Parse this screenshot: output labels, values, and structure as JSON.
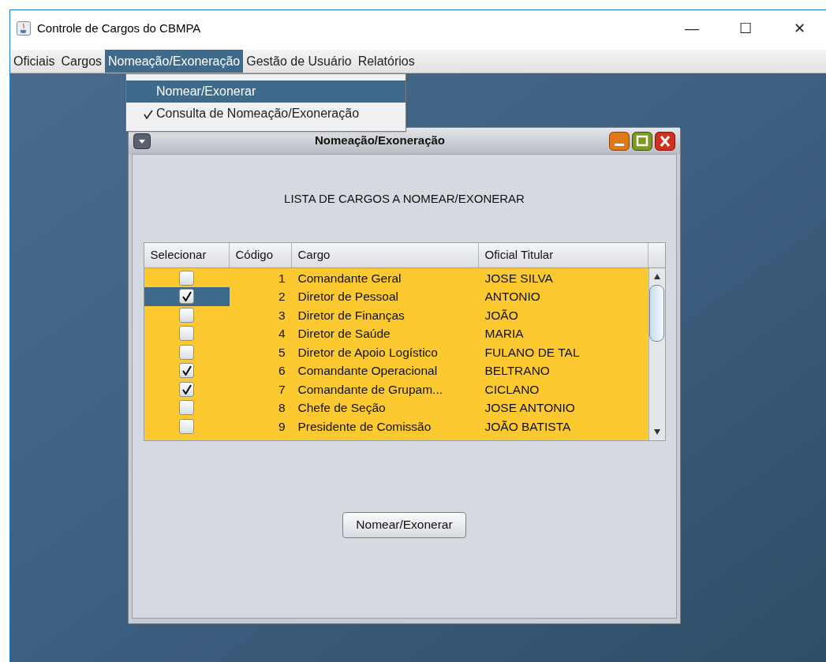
{
  "window": {
    "title": "Controle de Cargos do CBMPA",
    "controls": [
      "—",
      "☐",
      "✕"
    ]
  },
  "menu_bar": [
    {
      "label": "Oficiais",
      "selected": false
    },
    {
      "label": "Cargos",
      "selected": false
    },
    {
      "label": "Nomeação/Exoneração",
      "selected": true
    },
    {
      "label": "Gestão de Usuário",
      "selected": false
    },
    {
      "label": "Relatórios",
      "selected": false
    }
  ],
  "dropdown": [
    {
      "label": "Nomear/Exonerar",
      "selected": true,
      "checked": false
    },
    {
      "label": "Consulta de Nomeação/Exoneração",
      "selected": false,
      "checked": true
    }
  ],
  "internal_frame": {
    "title": "Nomeação/Exoneração",
    "heading": "LISTA DE CARGOS A NOMEAR/EXONERAR",
    "table": {
      "columns": [
        "Selecionar",
        "Código",
        "Cargo",
        "Oficial Titular"
      ],
      "rows": [
        {
          "checked": false,
          "selected": false,
          "code": "1",
          "cargo": "Comandante Geral",
          "oficial": "JOSE SILVA"
        },
        {
          "checked": true,
          "selected": true,
          "code": "2",
          "cargo": "Diretor de Pessoal",
          "oficial": "ANTONIO"
        },
        {
          "checked": false,
          "selected": false,
          "code": "3",
          "cargo": "Diretor de Finanças",
          "oficial": "JOÃO"
        },
        {
          "checked": false,
          "selected": false,
          "code": "4",
          "cargo": "Diretor de Saúde",
          "oficial": "MARIA"
        },
        {
          "checked": false,
          "selected": false,
          "code": "5",
          "cargo": "Diretor de Apoio Logístico",
          "oficial": "FULANO DE TAL"
        },
        {
          "checked": true,
          "selected": false,
          "code": "6",
          "cargo": "Comandante Operacional",
          "oficial": "BELTRANO"
        },
        {
          "checked": true,
          "selected": false,
          "code": "7",
          "cargo": "Comandante de Grupam...",
          "oficial": "CICLANO"
        },
        {
          "checked": false,
          "selected": false,
          "code": "8",
          "cargo": "Chefe de Seção",
          "oficial": "JOSE ANTONIO"
        },
        {
          "checked": false,
          "selected": false,
          "code": "9",
          "cargo": "Presidente de Comissão",
          "oficial": "JOÃO BATISTA"
        }
      ]
    },
    "button": "Nomear/Exonerar"
  }
}
